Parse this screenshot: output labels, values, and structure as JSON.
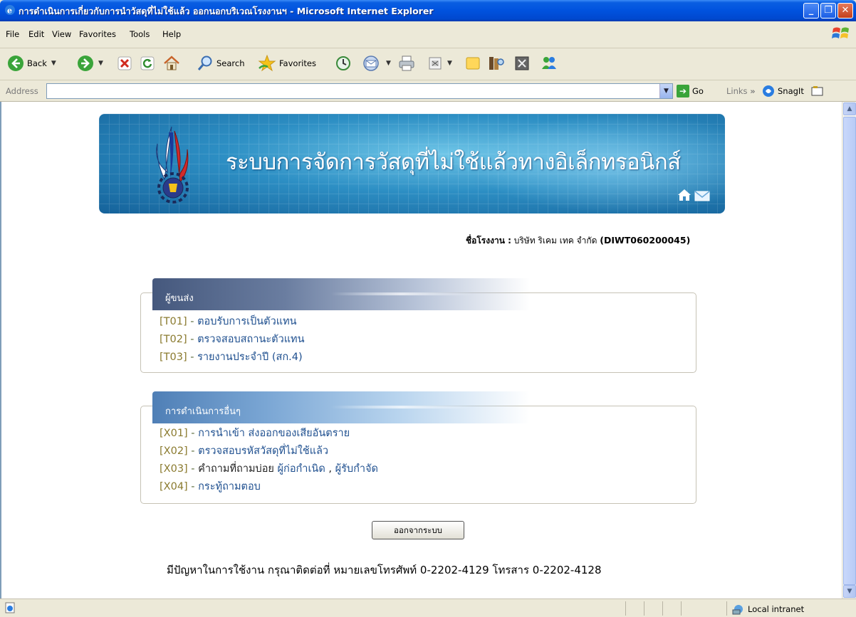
{
  "window": {
    "title": "การดำเนินการเกี่ยวกับการนำวัสดุที่ไม่ใช้แล้ว ออกนอกบริเวณโรงงานฯ - Microsoft Internet Explorer"
  },
  "menu": [
    "File",
    "Edit",
    "View",
    "Favorites",
    "Tools",
    "Help"
  ],
  "toolbar": {
    "back_label": "Back",
    "search_label": "Search",
    "favorites_label": "Favorites"
  },
  "address": {
    "label": "Address",
    "value": "",
    "go_label": "Go",
    "links_label": "Links",
    "snagit_label": "SnagIt"
  },
  "banner": {
    "title": "ระบบการจัดการวัสดุที่ไม่ใช้แล้วทางอิเล็กทรอนิกส์"
  },
  "factory": {
    "label": "ชื่อโรงงาน :",
    "name": "บริษัท ริเคม เทค จำกัด",
    "id": "(DIWT060200045)"
  },
  "section_transport": {
    "title": "ผู้ขนส่ง",
    "items": [
      {
        "code": "[T01]",
        "text": "ตอบรับการเป็นตัวแทน"
      },
      {
        "code": "[T02]",
        "text": "ตรวจสอบสถานะตัวแทน"
      },
      {
        "code": "[T03]",
        "text": "รายงานประจำปี (สก.4)"
      }
    ]
  },
  "section_other": {
    "title": "การดำเนินการอื่นๆ",
    "items": [
      {
        "code": "[X01]",
        "text": "การนำเข้า ส่งออกของเสียอันตราย"
      },
      {
        "code": "[X02]",
        "text": "ตรวจสอบรหัสวัสดุที่ไม่ใช้แล้ว"
      },
      {
        "code": "[X03]",
        "text": "คำถามที่ถามบ่อย",
        "link1": "ผู้ก่อกำเนิด",
        "sep": ",",
        "link2": "ผู้รับกำจัด"
      },
      {
        "code": "[X04]",
        "text": "กระทู้ถามตอบ"
      }
    ]
  },
  "logout_label": "ออกจากระบบ",
  "contact_text": "มีปัญหาในการใช้งาน กรุณาติดต่อที่ หมายเลขโทรศัพท์ 0-2202-4129 โทรสาร 0-2202-4128",
  "status": {
    "zone_label": "Local intranet"
  },
  "colors": {
    "titlebar": "#0052de",
    "link": "#1e4f8f",
    "code": "#8a7a2e"
  }
}
